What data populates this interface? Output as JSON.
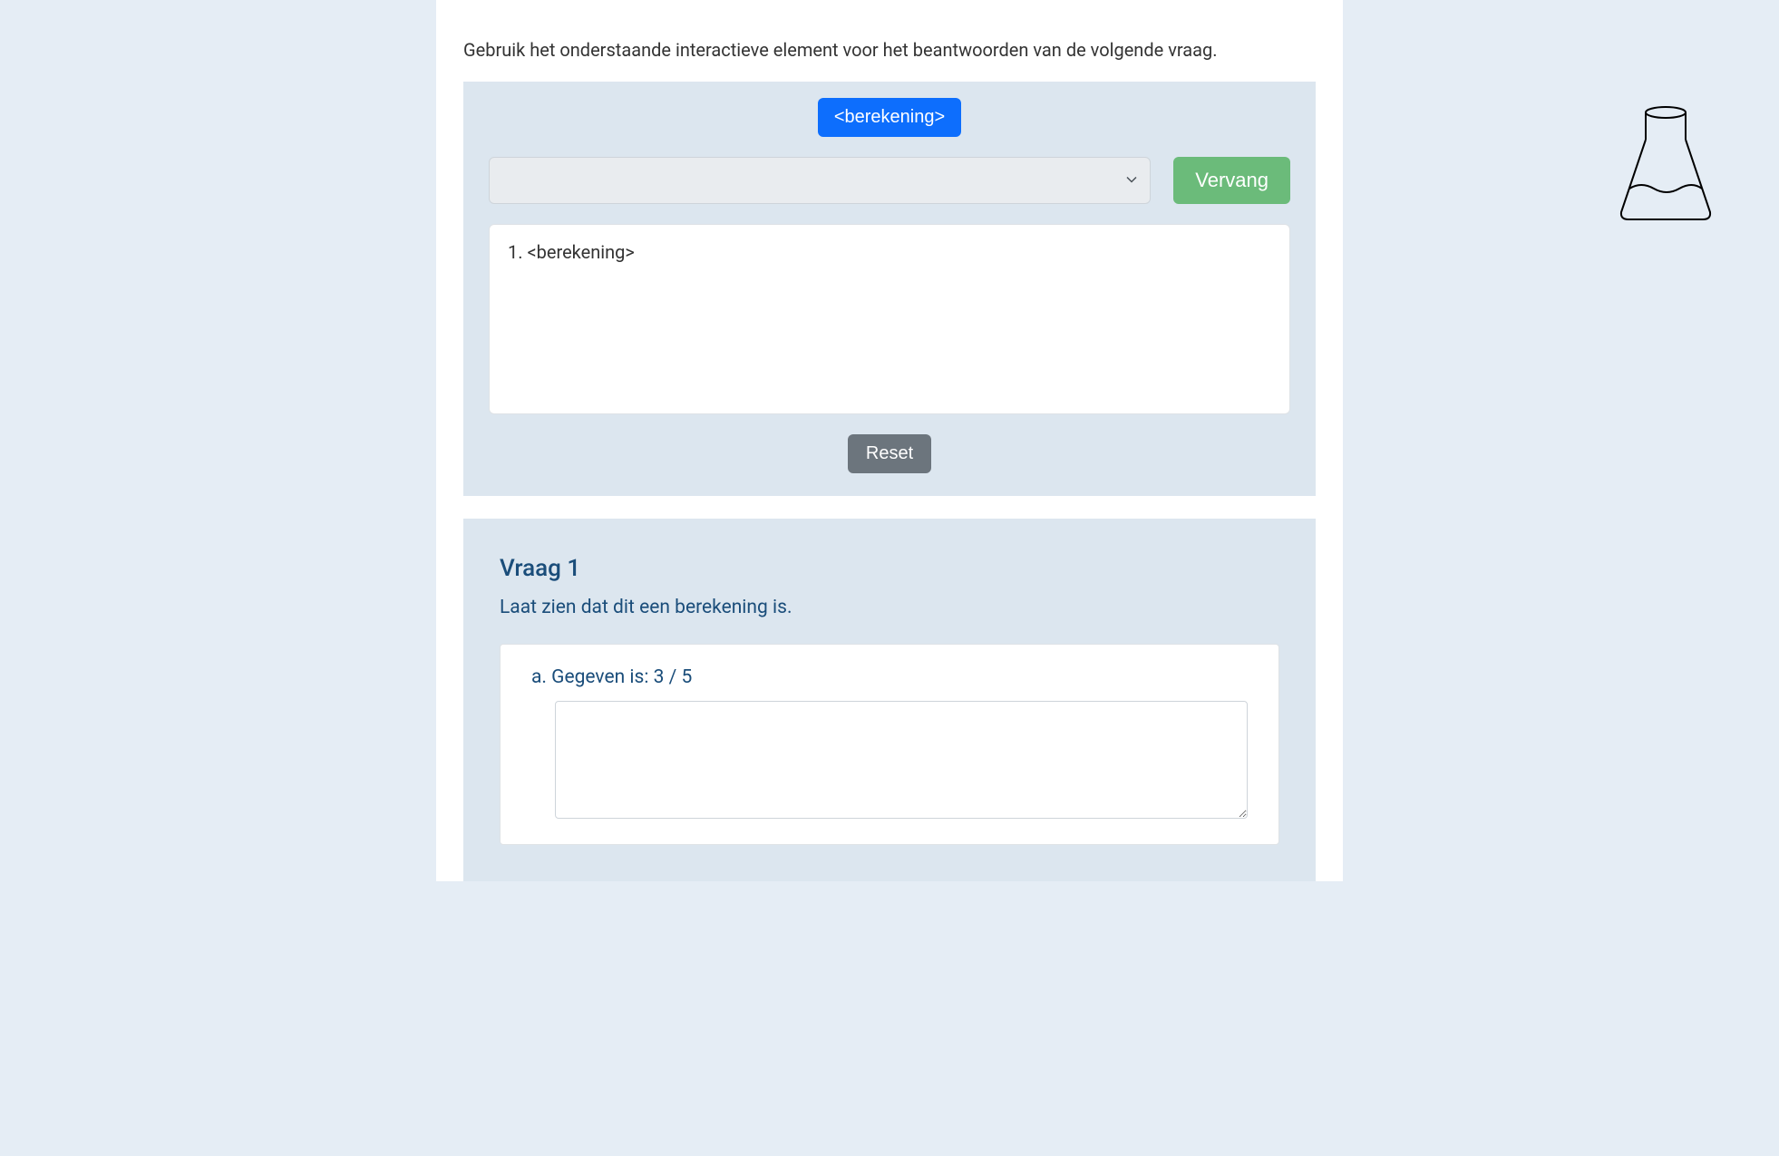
{
  "instruction": "Gebruik het onderstaande interactieve element voor het beantwoorden van de volgende vraag.",
  "interactive": {
    "calc_button_label": "<berekening>",
    "replace_button_label": "Vervang",
    "output_text": "1. <berekening>",
    "reset_button_label": "Reset"
  },
  "question": {
    "title": "Vraag 1",
    "prompt": "Laat zien dat dit een berekening is.",
    "answer_label": "a. Gegeven is: 3 / 5"
  }
}
